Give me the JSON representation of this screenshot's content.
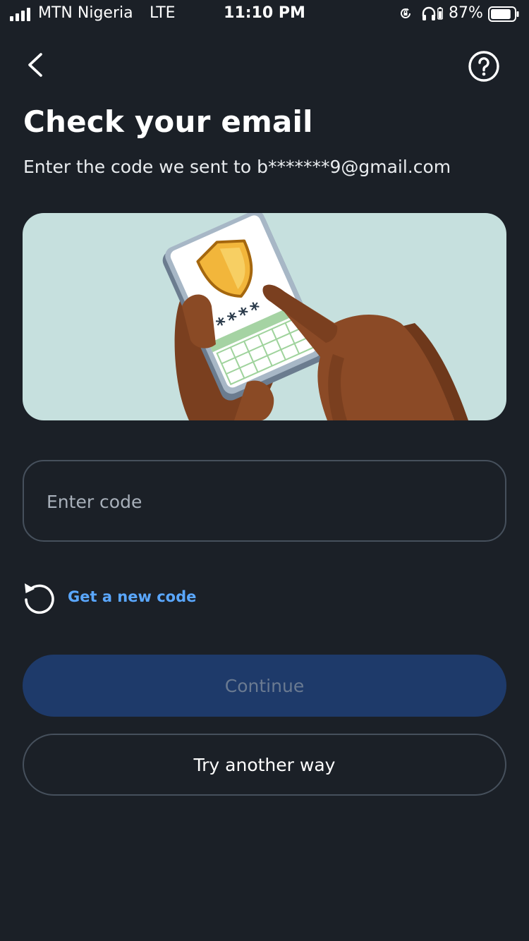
{
  "status_bar": {
    "carrier": "MTN Nigeria",
    "network": "LTE",
    "time": "11:10 PM",
    "battery_percent": "87%",
    "battery_level": 0.87,
    "signal_bars": 4
  },
  "header": {
    "back_icon": "chevron-left-icon",
    "help_icon": "question-circle-icon"
  },
  "title": "Check your email",
  "subtitle": "Enter the code we sent to b*******9@gmail.com",
  "illustration": {
    "code_mask": "****"
  },
  "code_input": {
    "placeholder": "Enter code",
    "value": ""
  },
  "new_code": {
    "icon": "refresh-icon",
    "label": "Get a new code"
  },
  "continue_button": {
    "label": "Continue"
  },
  "another_way_button": {
    "label": "Try another way"
  },
  "colors": {
    "background": "#1b2027",
    "link": "#5aa7ff",
    "primary_button": "#1e3a6a",
    "illustration_bg": "#c6e0de"
  }
}
